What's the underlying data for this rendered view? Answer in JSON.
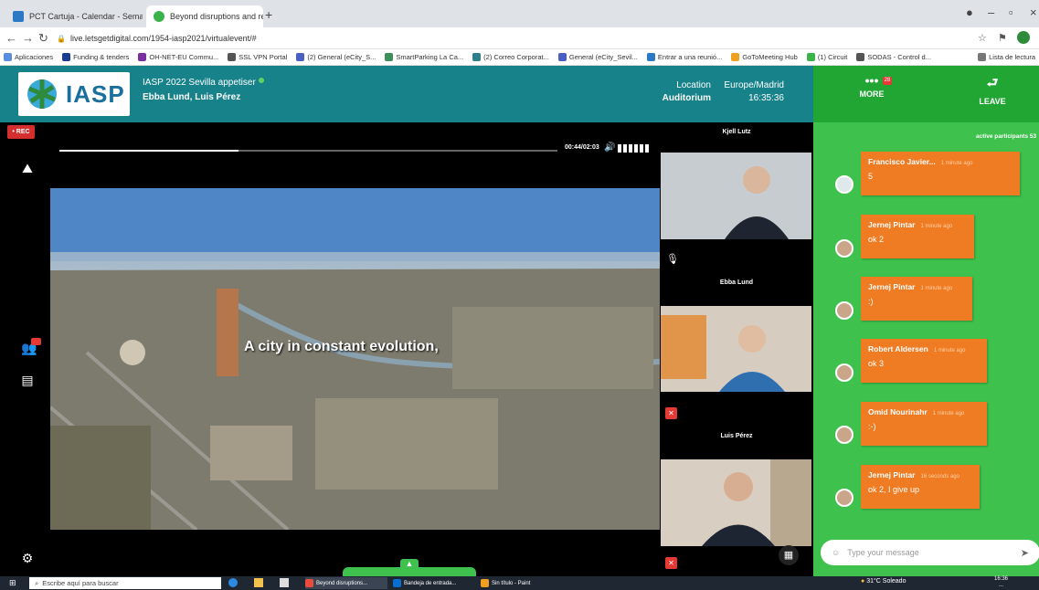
{
  "browser": {
    "tabs": [
      {
        "label": "PCT Cartuja - Calendar - Semana",
        "active": false,
        "icon": "calendar-icon"
      },
      {
        "label": "Beyond disruptions and rec",
        "active": true,
        "icon": "iasp-icon"
      }
    ],
    "url": "live.letsgetdigital.com/1954-iasp2021/virtualevent/#",
    "bookmarks": [
      "Aplicaciones",
      "Funding & tenders",
      "OH-NET-EU Commu...",
      "SSL VPN Portal",
      "(2) General (eCity_S...",
      "SmartParking La Ca...",
      "(2) Correo Corporat...",
      "General (eCity_Sevil...",
      "Entrar a una reunió...",
      "GoToMeeting Hub",
      "(1) Circuit",
      "SODAS - Control d...",
      "Lista de lectura"
    ]
  },
  "header": {
    "logo_text": "IASP",
    "event_title": "IASP 2022 Sevilla appetiser",
    "presenters": "Ebba Lund, Luis Pérez",
    "location_label": "Location",
    "location_value": "Auditorium",
    "timezone_label": "Europe/Madrid",
    "time": "16:35:36",
    "more_label": "MORE",
    "more_badge": "28",
    "leave_label": "LEAVE"
  },
  "sidebar": {
    "rec_label": "• REC"
  },
  "player": {
    "timecode": "00:44/02:03",
    "progress": 0.36,
    "subtitle": "A city in constant evolution,"
  },
  "participants": [
    {
      "name": "Kjell Lutz",
      "muted": false
    },
    {
      "name": "Ebba Lund",
      "muted": true
    },
    {
      "name": "Luis Pérez",
      "muted": true
    }
  ],
  "chat": {
    "active_label": "active participants 53",
    "messages": [
      {
        "author": "Francisco Javier...",
        "time": "1 minute ago",
        "text": "5"
      },
      {
        "author": "Jernej Pintar",
        "time": "1 minute ago",
        "text": "ok 2"
      },
      {
        "author": "Jernej Pintar",
        "time": "1 minute ago",
        "text": ":)"
      },
      {
        "author": "Robert Aldersen",
        "time": "1 minute ago",
        "text": "ok 3"
      },
      {
        "author": "Omid Nourinahr",
        "time": "1 minute ago",
        "text": ":-)"
      },
      {
        "author": "Jernej Pintar",
        "time": "16 seconds ago",
        "text": "ok 2, I give up"
      }
    ],
    "input_placeholder": "Type your message"
  },
  "taskbar": {
    "search_placeholder": "Escribe aquí para buscar",
    "apps": [
      "Beyond disruptions...",
      "Bandeja de entrada...",
      "Sin título - Paint"
    ],
    "weather": "31°C Soleado",
    "time": "16:36",
    "date": "..."
  },
  "colors": {
    "header": "#17828a",
    "chat_bg": "#3ec24d",
    "bubble": "#ef7b22",
    "rec": "#d32f2f"
  }
}
